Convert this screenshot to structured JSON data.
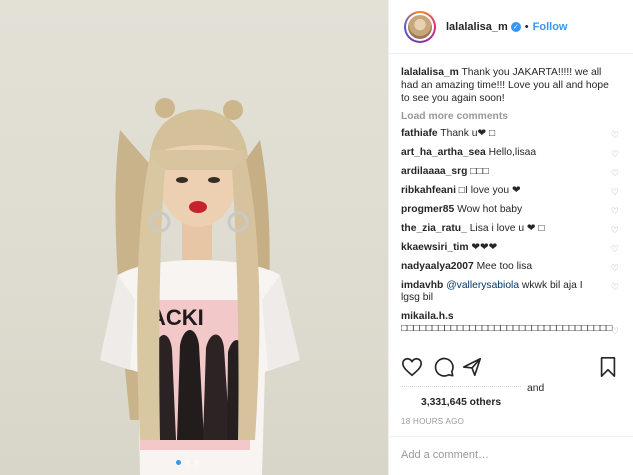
{
  "header": {
    "username": "lalalalisa_m",
    "verified_mark": "✓",
    "separator": "•",
    "follow_label": "Follow"
  },
  "caption": {
    "username": "lalalalisa_m",
    "text": " Thank you JAKARTA!!!!! we all had an amazing time!!! Love you all and hope to see you again soon!"
  },
  "load_more_label": "Load more comments",
  "comments": [
    {
      "user": "fathiafe",
      "text": " Thank u❤ □"
    },
    {
      "user": "art_ha_artha_sea",
      "text": " Hello,lisaa"
    },
    {
      "user": "ardilaaaa_srg",
      "text": " □□□"
    },
    {
      "user": "ribkahfeani",
      "text": " □I love you ❤"
    },
    {
      "user": "progmer85",
      "text": " Wow hot baby"
    },
    {
      "user": "the_zia_ratu_",
      "text": " Lisa i love u ❤ □"
    },
    {
      "user": "kkaewsiri_tim",
      "text": " ❤❤❤"
    },
    {
      "user": "nadyaalya2007",
      "text": " Mee too lisa"
    },
    {
      "user": "imdavhb",
      "mention": "@vallerysabiola",
      "text": " wkwk bil aja I lgsg bil"
    },
    {
      "user": "mikaila.h.s",
      "text": " □□□□□□□□□□□□□□□□□□□□□□□□□□□□□□□□□□"
    }
  ],
  "likes": {
    "and_label": "and",
    "count": "3,331,645 others"
  },
  "timestamp": "18 HOURS AGO",
  "add_comment_placeholder": "Add a comment…",
  "icons": {
    "like": "heart-icon",
    "comment": "comment-bubble-icon",
    "share": "share-icon",
    "save": "bookmark-icon",
    "comment_like": "small-heart-icon"
  },
  "colors": {
    "accent": "#3897f0",
    "text": "#262626",
    "muted": "#999999"
  },
  "carousel": {
    "slides": 3,
    "active": 1
  }
}
